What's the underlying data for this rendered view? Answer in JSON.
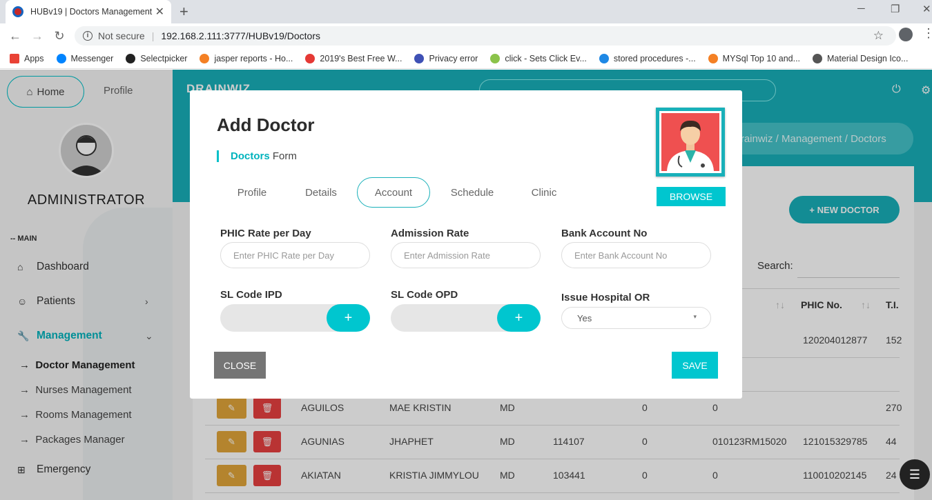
{
  "browser": {
    "tab_title": "HUBv19 | Doctors Management",
    "not_secure": "Not secure",
    "url": "192.168.2.111:3777/HUBv19/Doctors",
    "bookmarks": [
      {
        "label": "Apps",
        "color": "#e94235"
      },
      {
        "label": "Messenger",
        "color": "#0084ff"
      },
      {
        "label": "Selectpicker",
        "color": "#222222"
      },
      {
        "label": "jasper reports - Ho...",
        "color": "#f48024"
      },
      {
        "label": "2019's Best Free W...",
        "color": "#e53935"
      },
      {
        "label": "Privacy error",
        "color": "#3f51b5"
      },
      {
        "label": "click - Sets Click Ev...",
        "color": "#8bc34a"
      },
      {
        "label": "stored procedures -...",
        "color": "#1e88e5"
      },
      {
        "label": "MYSql Top 10 and...",
        "color": "#f48024"
      },
      {
        "label": "Material Design Ico...",
        "color": "#555555"
      }
    ]
  },
  "sidebar": {
    "home_label": "Home",
    "profile_label": "Profile",
    "role": "ADMINISTRATOR",
    "section_main": "-- MAIN",
    "dashboard": "Dashboard",
    "patients": "Patients",
    "management": "Management",
    "submenu": [
      "Doctor Management",
      "Nurses Management",
      "Rooms Management",
      "Packages Manager"
    ],
    "emergency": "Emergency",
    "arrow": "→"
  },
  "header": {
    "brand": "DRAINWIZ",
    "breadcrumb": "Drainwiz  /  Management  /  Doctors"
  },
  "page": {
    "new_doctor": "+ NEW DOCTOR",
    "search_label": "Search:",
    "columns": {
      "phic_no": "PHIC No.",
      "ti": "T.I."
    },
    "rows": [
      {
        "last": "",
        "first": "",
        "suffix": "",
        "c4": "",
        "c5": "",
        "c6": "",
        "phic": "120204012877",
        "ti": "152"
      },
      {
        "last": "",
        "first": "",
        "suffix": "",
        "c4": "",
        "c5": "",
        "c6": "",
        "phic": "",
        "ti": ""
      },
      {
        "last": "AGUILOS",
        "first": "MAE KRISTIN",
        "suffix": "MD",
        "c4": "",
        "c5": "0",
        "c6": "0",
        "phic": "",
        "ti": "270"
      },
      {
        "last": "AGUNIAS",
        "first": "JHAPHET",
        "suffix": "MD",
        "c4": "114107",
        "c5": "0",
        "c6": "010123RM15020",
        "phic": "121015329785",
        "ti": "44"
      },
      {
        "last": "AKIATAN",
        "first": "KRISTIA JIMMYLOU",
        "suffix": "MD",
        "c4": "103441",
        "c5": "0",
        "c6": "0",
        "phic": "110010202145",
        "ti": "24"
      }
    ]
  },
  "modal": {
    "title": "Add Doctor",
    "subtitle_bold": "Doctors",
    "subtitle_rest": " Form",
    "browse": "BROWSE",
    "tabs": [
      "Profile",
      "Details",
      "Account",
      "Schedule",
      "Clinic"
    ],
    "active_tab": "Account",
    "fields": {
      "phic_rate_label": "PHIC Rate per Day",
      "phic_rate_placeholder": "Enter PHIC Rate per Day",
      "admission_label": "Admission Rate",
      "admission_placeholder": "Enter Admission Rate",
      "bank_label": "Bank Account No",
      "bank_placeholder": "Enter Bank Account No",
      "sl_ipd_label": "SL Code IPD",
      "sl_opd_label": "SL Code OPD",
      "issue_or_label": "Issue Hospital OR",
      "issue_or_value": "Yes"
    },
    "close": "CLOSE",
    "save": "SAVE"
  },
  "colors": {
    "accent": "#18b0b9",
    "teal_button": "#00c6cf",
    "edit": "#e2a63a",
    "delete": "#e84040"
  }
}
